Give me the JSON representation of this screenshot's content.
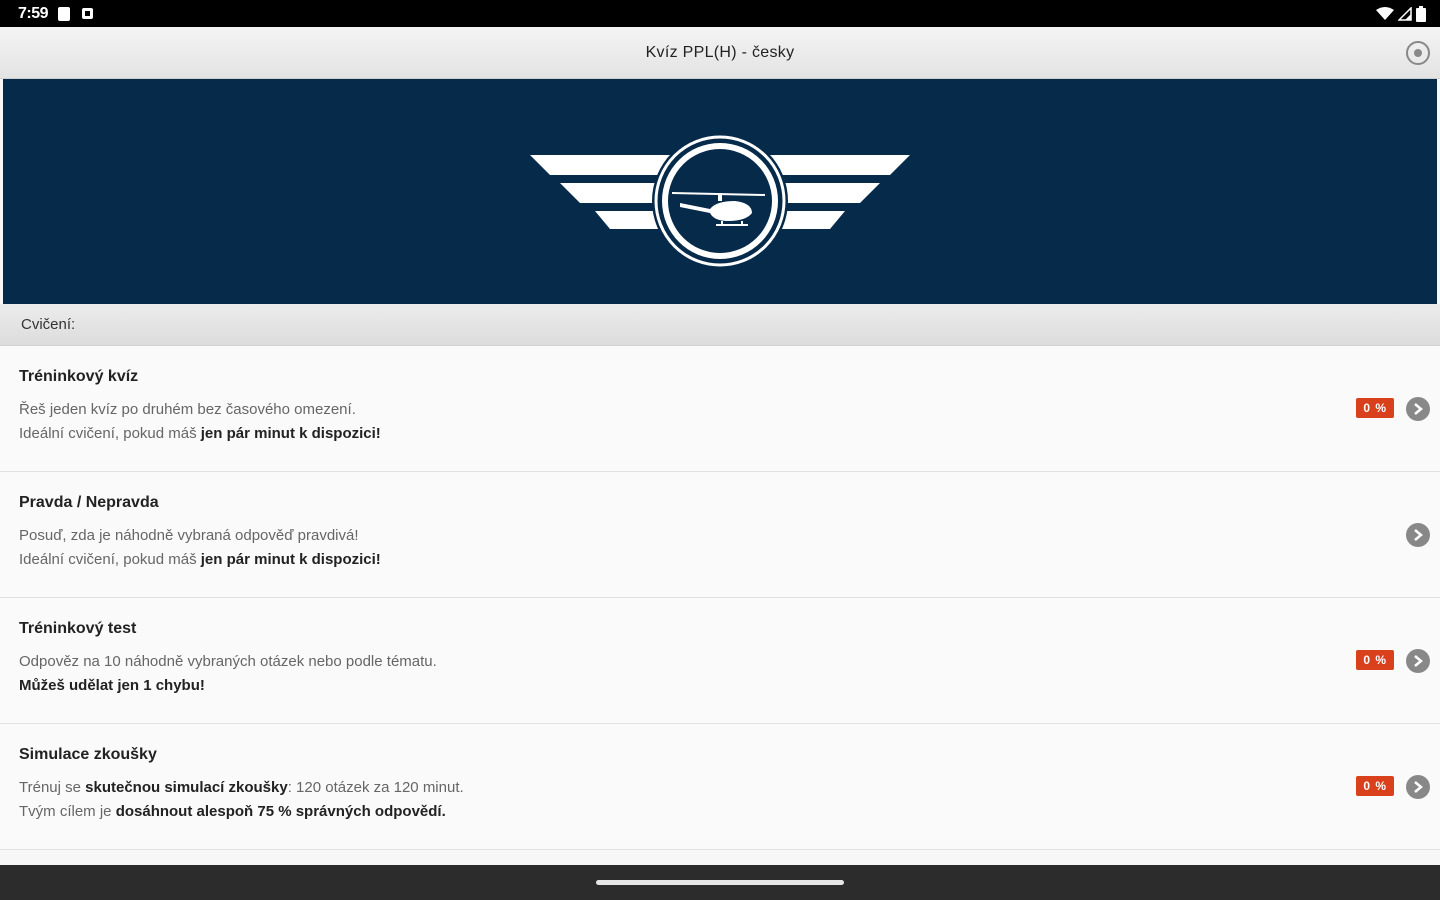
{
  "status_bar": {
    "time": "7:59"
  },
  "app_bar": {
    "title": "Kvíz PPL(H) - česky"
  },
  "section": {
    "title": "Cvičení:"
  },
  "items": [
    {
      "title": "Tréninkový kvíz",
      "line1": "Řeš jeden kvíz po druhém bez časového omezení.",
      "line2_normal": "Ideální cvičení, pokud máš ",
      "line2_bold": "jen pár minut k dispozici!",
      "badge": "0 %"
    },
    {
      "title": "Pravda / Nepravda",
      "line1": "Posuď, zda je náhodně vybraná odpověď pravdivá!",
      "line2_normal": "Ideální cvičení, pokud máš ",
      "line2_bold": "jen pár minut k dispozici!"
    },
    {
      "title": "Tréninkový test",
      "line1": "Odpověz na 10 náhodně vybraných otázek nebo podle tématu.",
      "line2_bold": "Můžeš udělat jen 1 chybu!",
      "badge": "0 %"
    },
    {
      "title": "Simulace zkoušky",
      "line1_a": "Trénuj se ",
      "line1_b": "skutečnou simulací zkoušky",
      "line1_c": ": 120 otázek za 120 minut.",
      "line2_a": "Tvým cílem je ",
      "line2_b": "dosáhnout alespoň 75 % správných odpovědí.",
      "badge": "0 %"
    }
  ],
  "colors": {
    "banner": "#062a4a",
    "badge": "#d8411c"
  }
}
